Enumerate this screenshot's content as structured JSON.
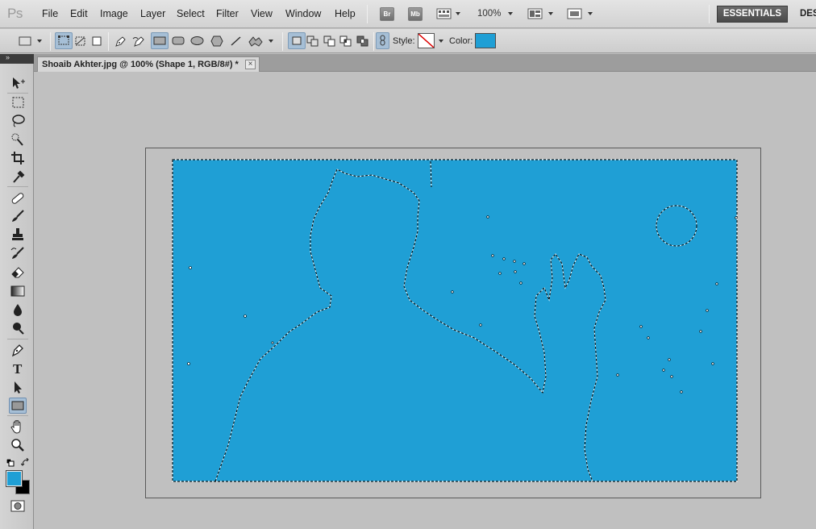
{
  "app": {
    "logo_text": "Ps"
  },
  "menu": {
    "items": [
      "File",
      "Edit",
      "Image",
      "Layer",
      "Select",
      "Filter",
      "View",
      "Window",
      "Help"
    ],
    "bridge_label": "Br",
    "mini_bridge_label": "Mb",
    "zoom_level": "100%",
    "workspace_active": "ESSENTIALS",
    "workspace_next": "DES"
  },
  "options": {
    "style_label": "Style:",
    "color_label": "Color:",
    "shape_color": "#1f9fd5"
  },
  "document": {
    "tab_title": "Shoaib Akhter.jpg @ 100% (Shape 1, RGB/8#) *",
    "close_glyph": "×",
    "fill_color": "#1f9fd5"
  },
  "tools": {
    "foreground_color": "#1f9fd5",
    "background_color": "#000000",
    "strip_arrows": "»",
    "type_tool_glyph": "T"
  },
  "icons": {
    "marquee": "rect-marquee-icon",
    "lasso": "lasso-icon",
    "move": "move-icon",
    "shape": "rectangle-shape-icon"
  }
}
